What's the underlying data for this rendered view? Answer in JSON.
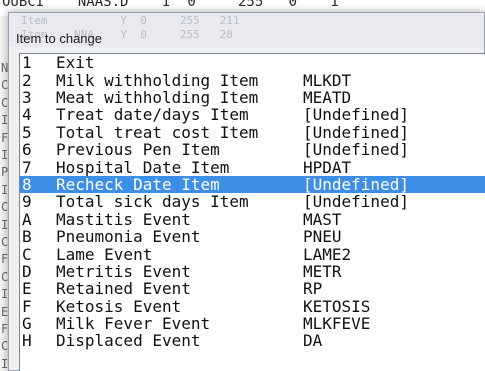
{
  "background": {
    "top_line_text": "OUBCI    NAAS.D    I  0     255   0    I",
    "left_column_chars": [
      "N",
      "C",
      "C",
      "I",
      "F",
      "I",
      "P",
      "I",
      "C",
      "I",
      "C",
      "F",
      "C",
      "I",
      "E",
      "F",
      "C",
      "I",
      "S"
    ]
  },
  "dialog": {
    "title": "Item to change",
    "ghost_rows": [
      {
        "left": "Item           Y  0     255   211",
        "right": ""
      },
      {
        "left": "Item    NNA    Y  0     255   28",
        "right": ""
      }
    ]
  },
  "list": {
    "selected_index": 8,
    "items": [
      {
        "key": "1",
        "label": "Exit",
        "code": ""
      },
      {
        "key": "2",
        "label": "Milk withholding Item",
        "code": "MLKDT"
      },
      {
        "key": "3",
        "label": "Meat withholding Item",
        "code": "MEATD"
      },
      {
        "key": "4",
        "label": "Treat date/days Item",
        "code": "[Undefined]"
      },
      {
        "key": "5",
        "label": "Total treat cost Item",
        "code": "[Undefined]"
      },
      {
        "key": "6",
        "label": "Previous Pen Item",
        "code": "[Undefined]"
      },
      {
        "key": "7",
        "label": "Hospital Date Item",
        "code": "HPDAT"
      },
      {
        "key": "8",
        "label": "Recheck Date Item",
        "code": "[Undefined]"
      },
      {
        "key": "9",
        "label": "Total sick days Item",
        "code": "[Undefined]"
      },
      {
        "key": "A",
        "label": "Mastitis Event",
        "code": "MAST"
      },
      {
        "key": "B",
        "label": "Pneumonia Event",
        "code": "PNEU"
      },
      {
        "key": "C",
        "label": "Lame Event",
        "code": "LAME2"
      },
      {
        "key": "D",
        "label": "Metritis Event",
        "code": "METR"
      },
      {
        "key": "E",
        "label": "Retained Event",
        "code": "RP"
      },
      {
        "key": "F",
        "label": "Ketosis Event",
        "code": "KETOSIS"
      },
      {
        "key": "G",
        "label": "Milk Fever Event",
        "code": "MLKFEVE"
      },
      {
        "key": "H",
        "label": "Displaced Event",
        "code": "DA"
      },
      {
        "key": "",
        "label": "",
        "code": ""
      }
    ]
  },
  "colors": {
    "selection": "#3d8ee6",
    "selection_text": "#ffffff",
    "list_text": "#111111"
  }
}
